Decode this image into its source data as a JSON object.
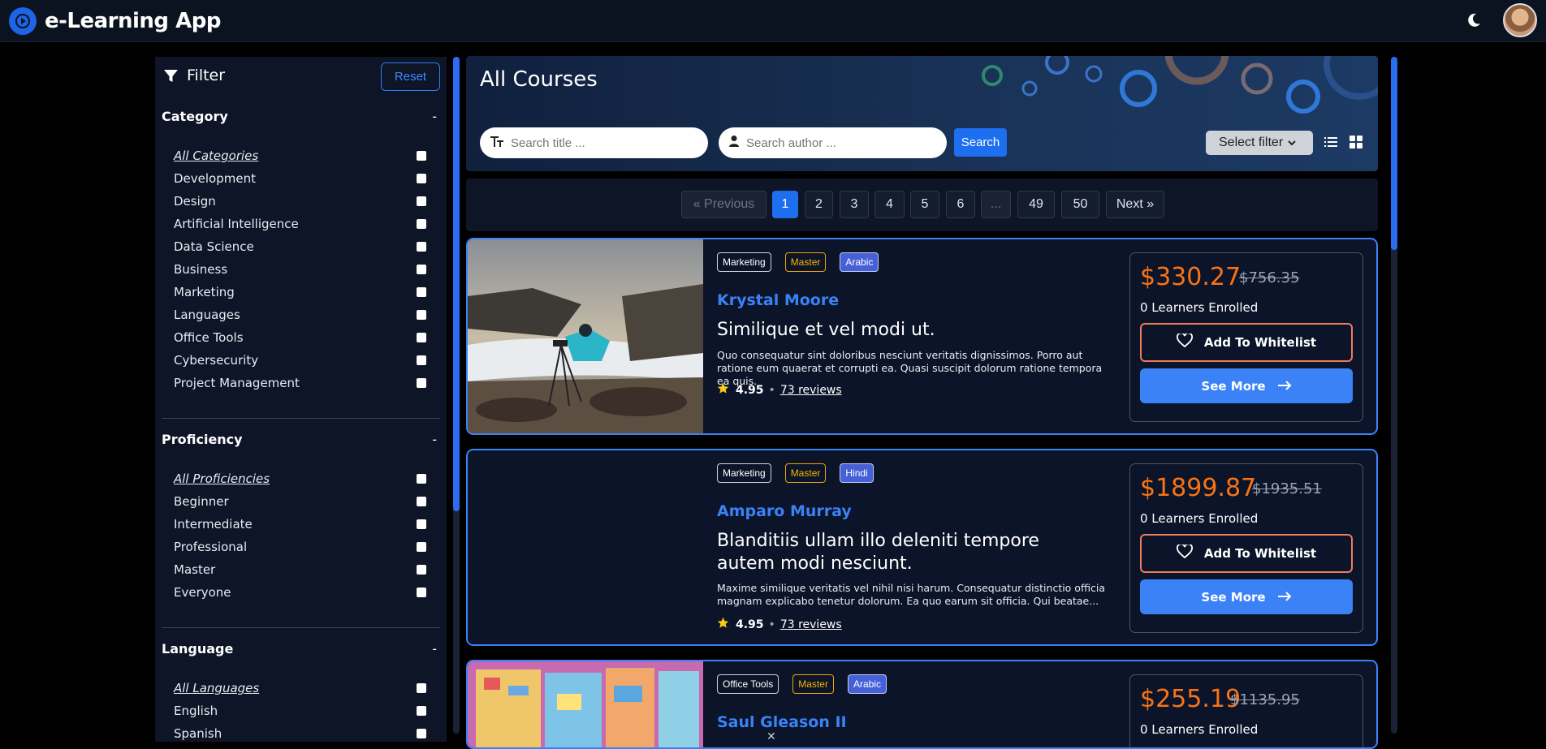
{
  "app": {
    "title": "e-Learning App"
  },
  "filter": {
    "title": "Filter",
    "reset_label": "Reset",
    "category": {
      "heading": "Category",
      "toggle": "-",
      "all_label": "All Categories",
      "options": [
        "Development",
        "Design",
        "Artificial Intelligence",
        "Data Science",
        "Business",
        "Marketing",
        "Languages",
        "Office Tools",
        "Cybersecurity",
        "Project Management"
      ]
    },
    "proficiency": {
      "heading": "Proficiency",
      "toggle": "-",
      "all_label": "All Proficiencies",
      "options": [
        "Beginner",
        "Intermediate",
        "Professional",
        "Master",
        "Everyone"
      ]
    },
    "language": {
      "heading": "Language",
      "toggle": "-",
      "all_label": "All Languages",
      "options": [
        "English",
        "Spanish"
      ]
    }
  },
  "header": {
    "title": "All Courses",
    "search_title_placeholder": "Search title ...",
    "search_author_placeholder": "Search author ...",
    "search_label": "Search",
    "select_filter": "Select filter"
  },
  "pagination": {
    "prev": "« Previous",
    "pages": [
      "1",
      "2",
      "3",
      "4",
      "5",
      "6",
      "...",
      "49",
      "50"
    ],
    "active_page": "1",
    "next": "Next »"
  },
  "courses": [
    {
      "tags": [
        "Marketing",
        "Master",
        "Arabic"
      ],
      "author": "Krystal Moore",
      "title": "Similique et vel modi ut.",
      "description": "Quo consequatur sint doloribus nesciunt veritatis dignissimos. Porro aut ratione eum quaerat et corrupti ea. Quasi suscipit dolorum ratione tempora ea quis.",
      "rating": "4.95",
      "reviews": "73 reviews",
      "price": "$330.27",
      "old_price": "$756.35",
      "enrolled": "0 Learners Enrolled",
      "whitelist_label": "Add To Whitelist",
      "see_more_label": "See More"
    },
    {
      "tags": [
        "Marketing",
        "Master",
        "Hindi"
      ],
      "author": "Amparo Murray",
      "title": "Blanditiis ullam illo deleniti tempore autem modi nesciunt.",
      "description": "Maxime similique veritatis vel nihil nisi harum. Consequatur distinctio officia magnam explicabo tenetur dolorum. Ea quo earum sit officia. Qui beatae...",
      "rating": "4.95",
      "reviews": "73 reviews",
      "price": "$1899.87",
      "old_price": "$1935.51",
      "enrolled": "0 Learners Enrolled",
      "whitelist_label": "Add To Whitelist",
      "see_more_label": "See More"
    },
    {
      "tags": [
        "Office Tools",
        "Master",
        "Arabic"
      ],
      "author": "Saul Gleason II",
      "price": "$255.19",
      "old_price": "$1135.95",
      "enrolled": "0 Learners Enrolled"
    }
  ],
  "colors": {
    "accent": "#3b82f6",
    "price": "#f97316",
    "level": "#f5b400"
  }
}
